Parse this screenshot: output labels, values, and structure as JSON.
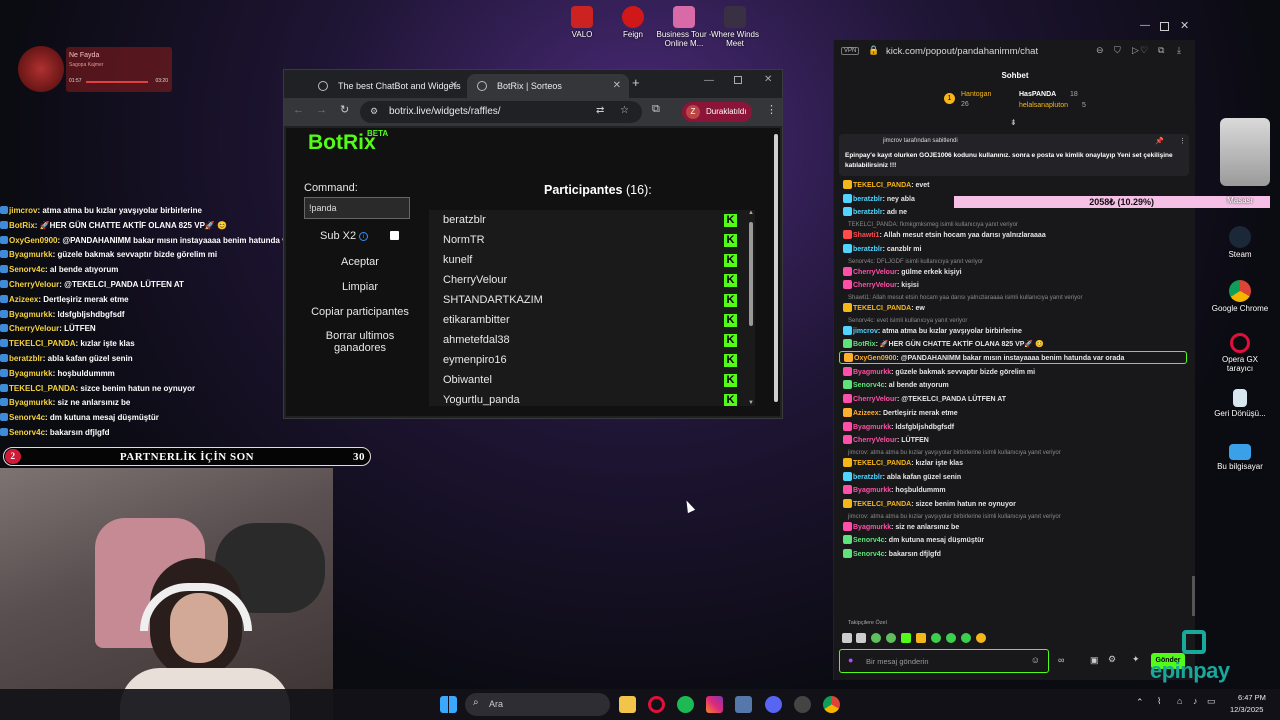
{
  "overlay_top": {
    "title": "Ne Fayda",
    "subtitle": "Sagopa Kajmer",
    "time_start": "01:57",
    "time_end": "03:20"
  },
  "desktop_top_icons": [
    {
      "label": "VALO"
    },
    {
      "label": "Feign"
    },
    {
      "label": "Business Tour - Online M..."
    },
    {
      "label": "Where Winds Meet"
    }
  ],
  "overlay_chat": [
    {
      "user": "jimcrov",
      "text": ": atma atma bu kızlar yavşıyolar birbirlerine"
    },
    {
      "user": "BotRix",
      "text": ": 🚀HER GÜN CHATTE AKTİF OLANA 825 VP🚀 😊"
    },
    {
      "user": "OxyGen0900",
      "text": ": @PANDAHANIMM bakar mısın instayaaaa benim hatunda var orada"
    },
    {
      "user": "Byagmurkk",
      "text": ": güzele bakmak sevvaptır bizde görelim mi"
    },
    {
      "user": "Senorv4c",
      "text": ": al bende atıyorum"
    },
    {
      "user": "CherryVelour",
      "text": ": @TEKELCI_PANDA LÜTFEN AT"
    },
    {
      "user": "Azizeex",
      "text": ": Dertleşiriz merak etme"
    },
    {
      "user": "Byagmurkk",
      "text": ": ldsfgbljshdbgfsdf"
    },
    {
      "user": "CherryVelour",
      "text": ": LÜTFEN"
    },
    {
      "user": "TEKELCI_PANDA",
      "text": ": kızlar işte klas"
    },
    {
      "user": "beratzblr",
      "text": ": abla kafan güzel senin"
    },
    {
      "user": "Byagmurkk",
      "text": ": hoşbuldummm"
    },
    {
      "user": "TEKELCI_PANDA",
      "text": ": sizce benim hatun ne oynuyor"
    },
    {
      "user": "Byagmurkk",
      "text": ": siz ne anlarsınız be"
    },
    {
      "user": "Senorv4c",
      "text": ": dm kutuna mesaj düşmüştür"
    },
    {
      "user": "Senorv4c",
      "text": ": bakarsın dfjlgfd"
    }
  ],
  "partner_bar": {
    "left_count": "2",
    "label": "PARTNERLİK İÇİN SON",
    "right_count": "30"
  },
  "browser": {
    "tabs": [
      {
        "label": "The best ChatBot and Widgets"
      },
      {
        "label": "BotRix | Sorteos"
      }
    ],
    "url": "botrix.live/widgets/raffles/",
    "profile_initial": "Z",
    "profile_label": "Duraklatıldı",
    "logo": "BotRix",
    "logo_badge": "BETA",
    "command_label": "Command:",
    "command_value": "!panda",
    "subx2_label": "Sub X2",
    "btn_aceptar": "Aceptar",
    "btn_limpiar": "Limpiar",
    "btn_copiar": "Copiar participantes",
    "btn_borrar": "Borrar ultimos ganadores",
    "participants_title": "Participantes",
    "participants_count": "(16):",
    "participants": [
      "beratzblr",
      "NormTR",
      "kunelf",
      "CherryVelour",
      "SHTANDARTKAZIM",
      "etikarambitter",
      "ahmetefdal38",
      "eymenpiro16",
      "Obiwantel",
      "Yogurtlu_panda"
    ]
  },
  "kick": {
    "vpn": "VPN",
    "url": "kick.com/popout/pandahanimm/chat",
    "header": "Sohbet",
    "leader1_name": "Hantogan",
    "leader1_count": "26",
    "leader2_name": "HasPANDA",
    "leader2_count": "18",
    "leader3_name": "helalsanapluton",
    "leader3_count": "5",
    "pinned_by": "jimcrov tarafından sabitlendi",
    "pinned_text": "Epinpay'e kayıt olurken GOJE1006 kodunu kullanınız. sonra e posta ve kimlik onaylayıp Yeni set çekilişine katılabilirsiniz !!!",
    "goal_text": "2058₺ (10.29%)",
    "followers_label": "Takipçilere Özel",
    "input_placeholder": "Bir mesaj gönderin",
    "send_label": "Gönder",
    "messages": [
      {
        "user": "TEKELCI_PANDA",
        "text": ": evet",
        "c": "yel"
      },
      {
        "user": "beratzblr",
        "text": ": ney abla",
        "c": "cy"
      },
      {
        "user": "beratzblr",
        "text": ": adı ne",
        "c": "cy"
      },
      {
        "reply": "TEKELCI_PANDA: fkmkgmksmeg isimli kullanıcıya yanıt veriyor"
      },
      {
        "user": "Shawti1",
        "text": ": Allah mesut etsin hocam yaa darısı yalnızlaraaaa",
        "c": "red"
      },
      {
        "user": "beratzblr",
        "text": ": canzblr mi",
        "c": "cy"
      },
      {
        "reply": "Senorv4c: DFLJGDF isimli kullanıcıya yanıt veriyor"
      },
      {
        "user": "CherryVelour",
        "text": ": gülme erkek kişiyi",
        "c": "pink"
      },
      {
        "user": "CherryVelour",
        "text": ": kişisi",
        "c": "pink"
      },
      {
        "reply": "Shawti1: Allah mesut etsin hocam yaa darısı yalnızlaraaaa isimli kullanıcıya yanıt veriyor"
      },
      {
        "user": "TEKELCI_PANDA",
        "text": ": ew",
        "c": "yel"
      },
      {
        "reply": "Senorv4c: evet isimli kullanıcıya yanıt veriyor"
      },
      {
        "user": "jimcrov",
        "text": ": atma atma bu kızlar yavşıyolar birbirlerine",
        "c": "cy"
      },
      {
        "user": "BotRix",
        "text": ": 🚀HER GÜN CHATTE AKTİF OLANA 825 VP🚀 😊",
        "c": "grn"
      },
      {
        "user": "OxyGen0900",
        "text": ": @PANDAHANIMM bakar mısın instayaaaa benim hatunda var orada",
        "c": "org"
      },
      {
        "user": "Byagmurkk",
        "text": ": güzele bakmak sevvaptır bizde görelim mi",
        "c": "pink"
      },
      {
        "user": "Senorv4c",
        "text": ": al bende atıyorum",
        "c": "grn"
      },
      {
        "user": "CherryVelour",
        "text": ": @TEKELCI_PANDA LÜTFEN AT",
        "c": "pink"
      },
      {
        "user": "Azizeex",
        "text": ": Dertleşiriz merak etme",
        "c": "org"
      },
      {
        "user": "Byagmurkk",
        "text": ": ldsfgbljshdbgfsdf",
        "c": "pink"
      },
      {
        "user": "CherryVelour",
        "text": ": LÜTFEN",
        "c": "pink"
      },
      {
        "reply": "jimcrov: atma atma bu kızlar yavşıyolar birbirlerine isimli kullanıcıya yanıt veriyor"
      },
      {
        "user": "TEKELCI_PANDA",
        "text": ": kızlar işte klas",
        "c": "yel"
      },
      {
        "user": "beratzblr",
        "text": ": abla kafan güzel senin",
        "c": "cy"
      },
      {
        "user": "Byagmurkk",
        "text": ": hoşbuldummm",
        "c": "pink"
      },
      {
        "user": "TEKELCI_PANDA",
        "text": ": sizce benim hatun ne oynuyor",
        "c": "yel"
      },
      {
        "reply": "jimcrov: atma atma bu kızlar yavşıyolar birbirlerine isimli kullanıcıya yanıt veriyor"
      },
      {
        "user": "Byagmurkk",
        "text": ": siz ne anlarsınız be",
        "c": "pink"
      },
      {
        "user": "Senorv4c",
        "text": ": dm kutuna mesaj düşmüştür",
        "c": "grn"
      },
      {
        "user": "Senorv4c",
        "text": ": bakarsın dfjlgfd",
        "c": "grn"
      }
    ]
  },
  "desktop_right_icons": [
    {
      "label": "Masası"
    },
    {
      "label": "Steam"
    },
    {
      "label": "Google Chrome"
    },
    {
      "label": "Opera GX tarayıcı"
    },
    {
      "label": "Geri Dönüşü..."
    },
    {
      "label": "Bu bilgisayar"
    }
  ],
  "epinpay_logo": "epinpay",
  "taskbar": {
    "search": "Ara",
    "time": "6:47 PM",
    "date": "12/3/2025"
  }
}
